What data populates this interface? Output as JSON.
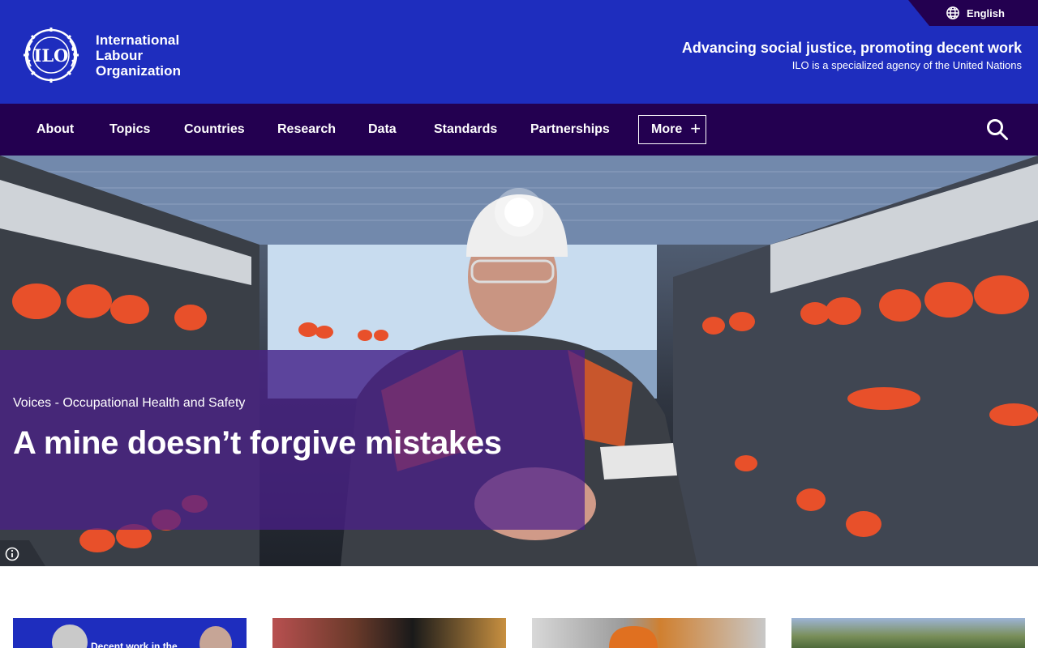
{
  "header": {
    "language": "English",
    "org_name_line1": "International",
    "org_name_line2": "Labour",
    "org_name_line3": "Organization",
    "logo_text": "ILO",
    "tagline": "Advancing social justice, promoting decent work",
    "subtagline": "ILO is a specialized agency of the United Nations"
  },
  "nav": {
    "items": [
      "About",
      "Topics",
      "Countries",
      "Research",
      "Data",
      "Standards",
      "Partnerships"
    ],
    "more_label": "More"
  },
  "hero": {
    "kicker": "Voices - Occupational Health and Safety",
    "title": "A mine doesn’t forgive mistakes"
  },
  "cards": {
    "card1_caption": "Decent work in the"
  },
  "colors": {
    "brand_blue": "#1e2dbe",
    "nav_purple": "#230050",
    "overlay_purple": "#4b1e8c"
  }
}
